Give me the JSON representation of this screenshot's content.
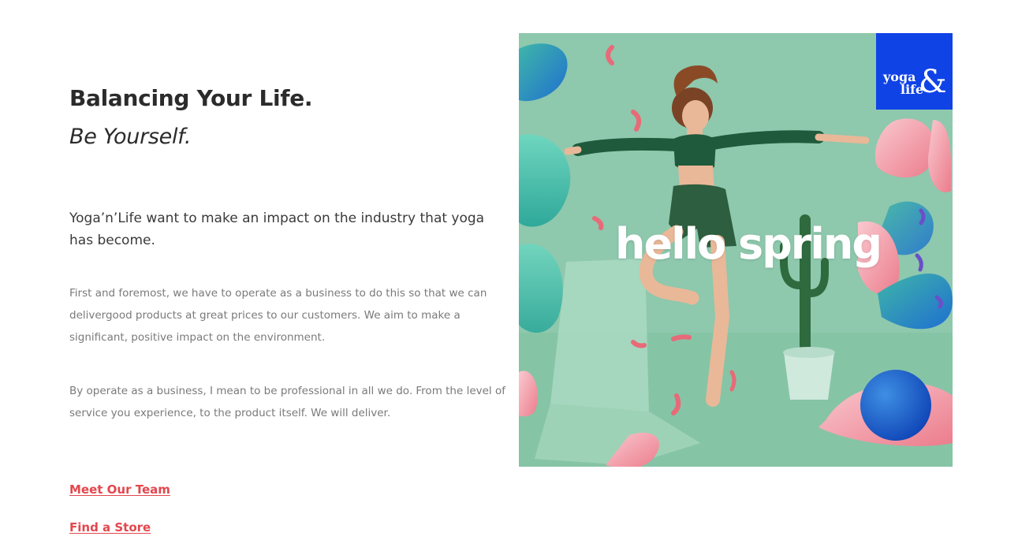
{
  "intro": {
    "title": "Balancing Your Life.",
    "subtitle": "Be Yourself.",
    "lead": "Yoga’n’Life want to make an impact on the industry that yoga has become.",
    "paragraphs": [
      "First and foremost, we have to operate as a business to do this so that we can delivergood products at great prices to our customers. We aim to make a significant, positive impact on the environment.",
      "By operate as a business, I mean to be professional in all we do. From the level of service you experience, to the product itself. We will deliver."
    ]
  },
  "links": {
    "meet_team": "Meet Our Team",
    "find_store": "Find a Store"
  },
  "hero": {
    "caption": "hello spring",
    "logo_line1": "yoga",
    "logo_line2": "life",
    "logo_symbol": "&",
    "background_color": "#8ec8ad",
    "logo_color": "#1043e6"
  },
  "colors": {
    "heading": "#2b2b2b",
    "body": "#7a7a7a",
    "link": "#e2474d"
  }
}
